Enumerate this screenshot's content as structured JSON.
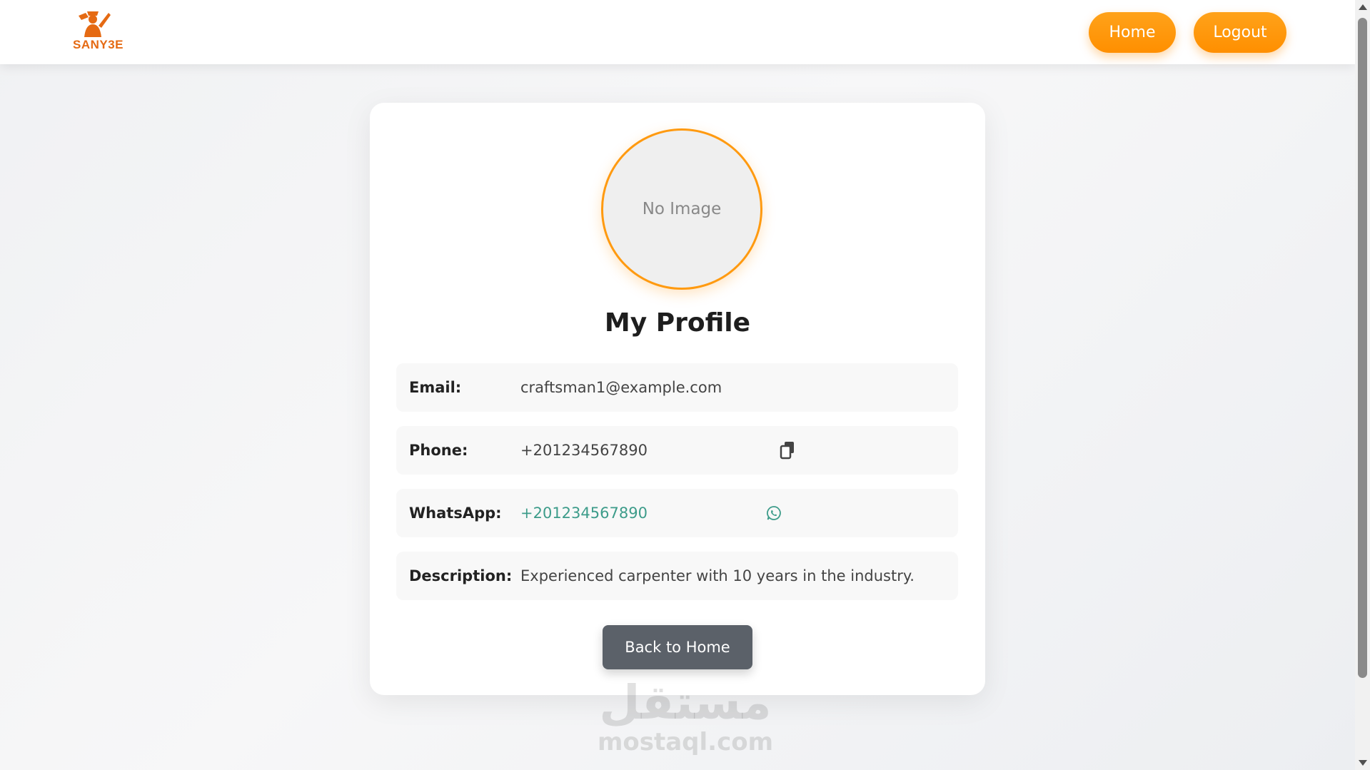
{
  "navbar": {
    "logo_text": "SANY3E",
    "home_label": "Home",
    "logout_label": "Logout"
  },
  "profile": {
    "avatar_placeholder": "No Image",
    "title": "My Profile",
    "fields": [
      {
        "label": "Email:",
        "value": "craftsman1@example.com"
      },
      {
        "label": "Phone:",
        "value": "+201234567890"
      },
      {
        "label": "WhatsApp:",
        "value": "+201234567890"
      },
      {
        "label": "Description:",
        "value": "Experienced carpenter with 10 years in the industry."
      }
    ],
    "back_label": "Back to Home"
  },
  "watermark": {
    "arabic": "مستقل",
    "latin": "mostaql.com"
  },
  "icons": {
    "copy": "copy-icon",
    "whatsapp": "whatsapp-icon",
    "logo": "craftsman-logo-icon"
  },
  "colors": {
    "accent": "#ff9a10",
    "logo": "#e56a13",
    "whatsapp_link": "#3d9c8a",
    "back_button": "#5b6169"
  }
}
